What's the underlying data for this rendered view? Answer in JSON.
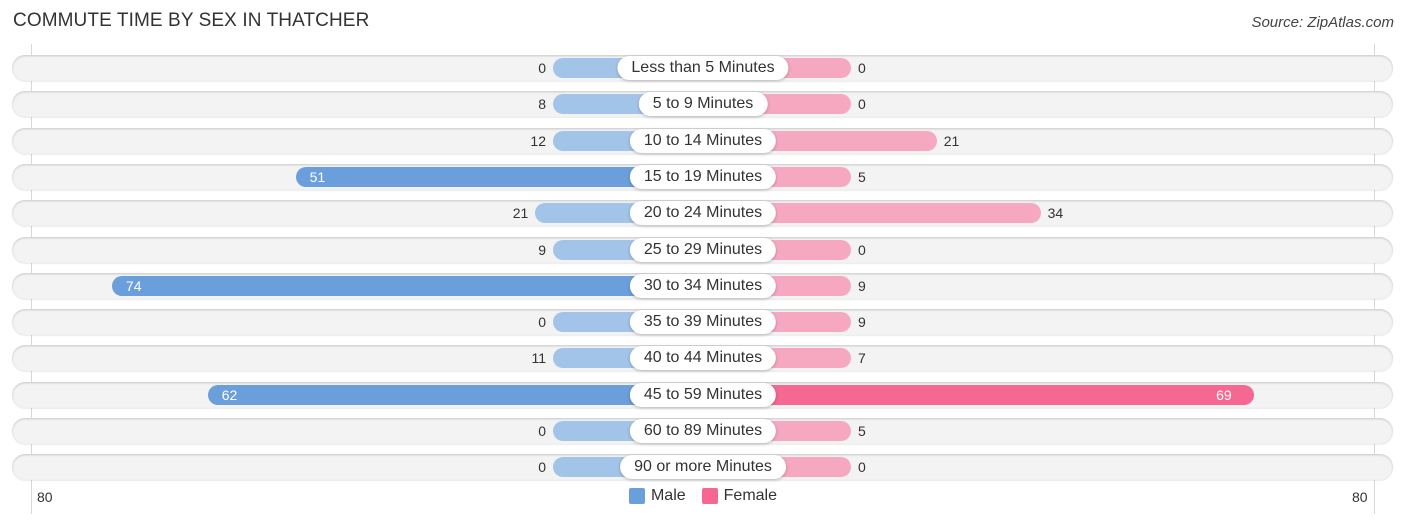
{
  "chart_data": {
    "type": "bar",
    "orientation": "horizontal-diverging",
    "title": "COMMUTE TIME BY SEX IN THATCHER",
    "source": "Source: ZipAtlas.com",
    "categories": [
      "Less than 5 Minutes",
      "5 to 9 Minutes",
      "10 to 14 Minutes",
      "15 to 19 Minutes",
      "20 to 24 Minutes",
      "25 to 29 Minutes",
      "30 to 34 Minutes",
      "35 to 39 Minutes",
      "40 to 44 Minutes",
      "45 to 59 Minutes",
      "60 to 89 Minutes",
      "90 or more Minutes"
    ],
    "series": [
      {
        "name": "Male",
        "color": "#6a9fdc",
        "light_color": "#a3c4e9",
        "values": [
          0,
          8,
          12,
          51,
          21,
          9,
          74,
          0,
          11,
          62,
          0,
          0
        ]
      },
      {
        "name": "Female",
        "color": "#f46891",
        "light_color": "#f6a8c1",
        "values": [
          0,
          0,
          21,
          5,
          34,
          0,
          9,
          9,
          7,
          69,
          5,
          0
        ]
      }
    ],
    "axis": {
      "left_max_label": "80",
      "right_max_label": "80",
      "max": 80
    },
    "legend": {
      "position": "bottom-center",
      "items": [
        "Male",
        "Female"
      ]
    }
  }
}
